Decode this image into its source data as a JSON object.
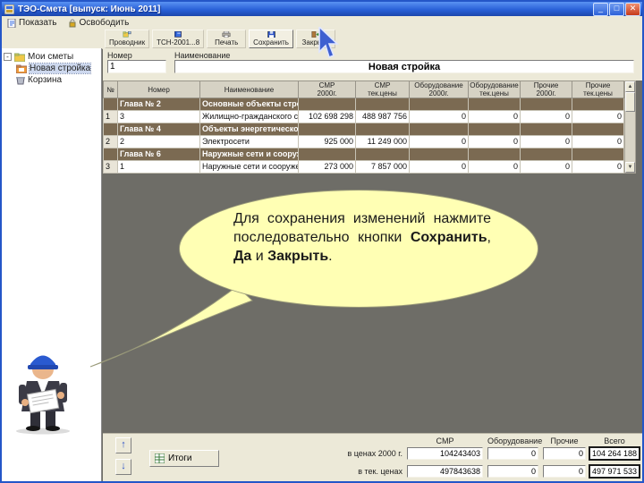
{
  "window": {
    "title": "ТЭО-Смета [выпуск: Июнь 2011]",
    "controls": {
      "minimize": "_",
      "maximize": "□",
      "close": "✕"
    }
  },
  "menubar": {
    "items": [
      {
        "label": "Показать"
      },
      {
        "label": "Освободить"
      }
    ]
  },
  "toolbar": {
    "buttons": [
      {
        "label": "Проводник"
      },
      {
        "label": "ТСН-2001...8"
      },
      {
        "label": "Печать"
      },
      {
        "label": "Сохранить"
      },
      {
        "label": "Закрыть"
      }
    ]
  },
  "tree": {
    "expander": "-",
    "items": [
      {
        "label": "Мои сметы"
      },
      {
        "label": "Новая стройка"
      },
      {
        "label": "Корзина"
      }
    ]
  },
  "form": {
    "number_label": "Номер",
    "number_value": "1",
    "name_label": "Наименование",
    "name_value": "Новая стройка"
  },
  "table": {
    "columns": [
      {
        "l1": "№",
        "l2": ""
      },
      {
        "l1": "Номер",
        "l2": ""
      },
      {
        "l1": "Наименование",
        "l2": ""
      },
      {
        "l1": "СМР",
        "l2": "2000г."
      },
      {
        "l1": "СМР",
        "l2": "тек.цены"
      },
      {
        "l1": "Оборудование",
        "l2": "2000г."
      },
      {
        "l1": "Оборудование",
        "l2": "тек.цены"
      },
      {
        "l1": "Прочие",
        "l2": "2000г."
      },
      {
        "l1": "Прочие",
        "l2": "тек.цены"
      }
    ],
    "rows": [
      {
        "kind": "chapter",
        "cells": [
          "",
          "Глава № 2",
          "Основные объекты строите...",
          "",
          "",
          "",
          "",
          "",
          ""
        ]
      },
      {
        "kind": "data",
        "cells": [
          "1",
          "3",
          "Жилищно-гражданского строительства...",
          "102 698 298",
          "488 987 756",
          "0",
          "0",
          "0",
          "0"
        ]
      },
      {
        "kind": "chapter",
        "cells": [
          "",
          "Глава № 4",
          "Объекты энергетического х...",
          "",
          "",
          "",
          "",
          "",
          ""
        ]
      },
      {
        "kind": "data",
        "cells": [
          "2",
          "2",
          "Электросети",
          "925 000",
          "11 249 000",
          "0",
          "0",
          "0",
          "0"
        ]
      },
      {
        "kind": "chapter",
        "cells": [
          "",
          "Глава № 6",
          "Наружные сети и сооруж...",
          "",
          "",
          "",
          "",
          "",
          ""
        ]
      },
      {
        "kind": "data",
        "cells": [
          "3",
          "1",
          "Наружные сети и сооружения вод...",
          "273 000",
          "7 857 000",
          "0",
          "0",
          "0",
          "0"
        ]
      }
    ]
  },
  "bubble": {
    "s0": "Для сохранения изменений нажмите последовательно кнопки ",
    "s1": "Сохранить",
    "s2": ", ",
    "s3": "Да",
    "s4": " и ",
    "s5": "Закрыть",
    "s6": "."
  },
  "totals": {
    "itogi_label": "Итоги",
    "up": "↑",
    "down": "↓",
    "col_labels": [
      "СМР",
      "Оборудование",
      "Прочие",
      "Всего"
    ],
    "row_labels": [
      "в ценах 2000 г.",
      "в тек. ценах"
    ],
    "values": [
      [
        "104243403",
        "0",
        "0",
        "104 264 188"
      ],
      [
        "497843638",
        "0",
        "0",
        "497 971 533"
      ]
    ]
  },
  "scrollbar": {
    "up": "▲",
    "down": "▼"
  },
  "colors": {
    "chapter_row": "#7b6a52",
    "bubble": "#ffffb4",
    "titlebar": "#2a61d8"
  }
}
